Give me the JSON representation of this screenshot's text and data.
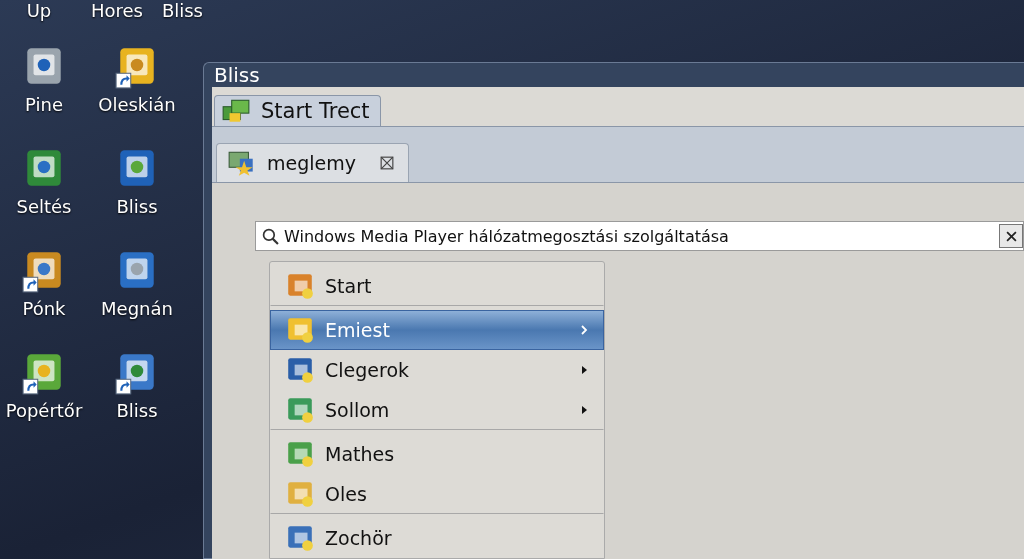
{
  "desktop": {
    "top_row": [
      {
        "label": "Up"
      },
      {
        "label": "Hores"
      },
      {
        "label": "Bliss"
      }
    ],
    "icons": [
      {
        "label": "Pine",
        "shortcut": false
      },
      {
        "label": "Oleskián",
        "shortcut": true
      },
      {
        "label": "Seltés",
        "shortcut": false
      },
      {
        "label": "Bliss",
        "shortcut": false
      },
      {
        "label": "Pónk",
        "shortcut": true
      },
      {
        "label": "Megnán",
        "shortcut": false
      },
      {
        "label": "Popértőr",
        "shortcut": true
      },
      {
        "label": "Bliss",
        "shortcut": true
      }
    ]
  },
  "window": {
    "title": "Bliss",
    "outer_tab": {
      "label": "Start Trect"
    },
    "inner_tab": {
      "label": "meglemy"
    },
    "search": {
      "value": "Windows Media Player hálózatmegosztási szolgáltatása"
    },
    "menu": [
      {
        "label": "Start",
        "selected": false,
        "submenu": false,
        "separator_after": true
      },
      {
        "label": "Emiest",
        "selected": true,
        "submenu": true,
        "separator_after": false
      },
      {
        "label": "Clegerok",
        "selected": false,
        "submenu": true,
        "separator_after": false
      },
      {
        "label": "Sollom",
        "selected": false,
        "submenu": true,
        "separator_after": true
      },
      {
        "label": "Mathes",
        "selected": false,
        "submenu": false,
        "separator_after": false
      },
      {
        "label": "Oles",
        "selected": false,
        "submenu": false,
        "separator_after": true
      },
      {
        "label": "Zochör",
        "selected": false,
        "submenu": false,
        "separator_after": false
      }
    ]
  }
}
